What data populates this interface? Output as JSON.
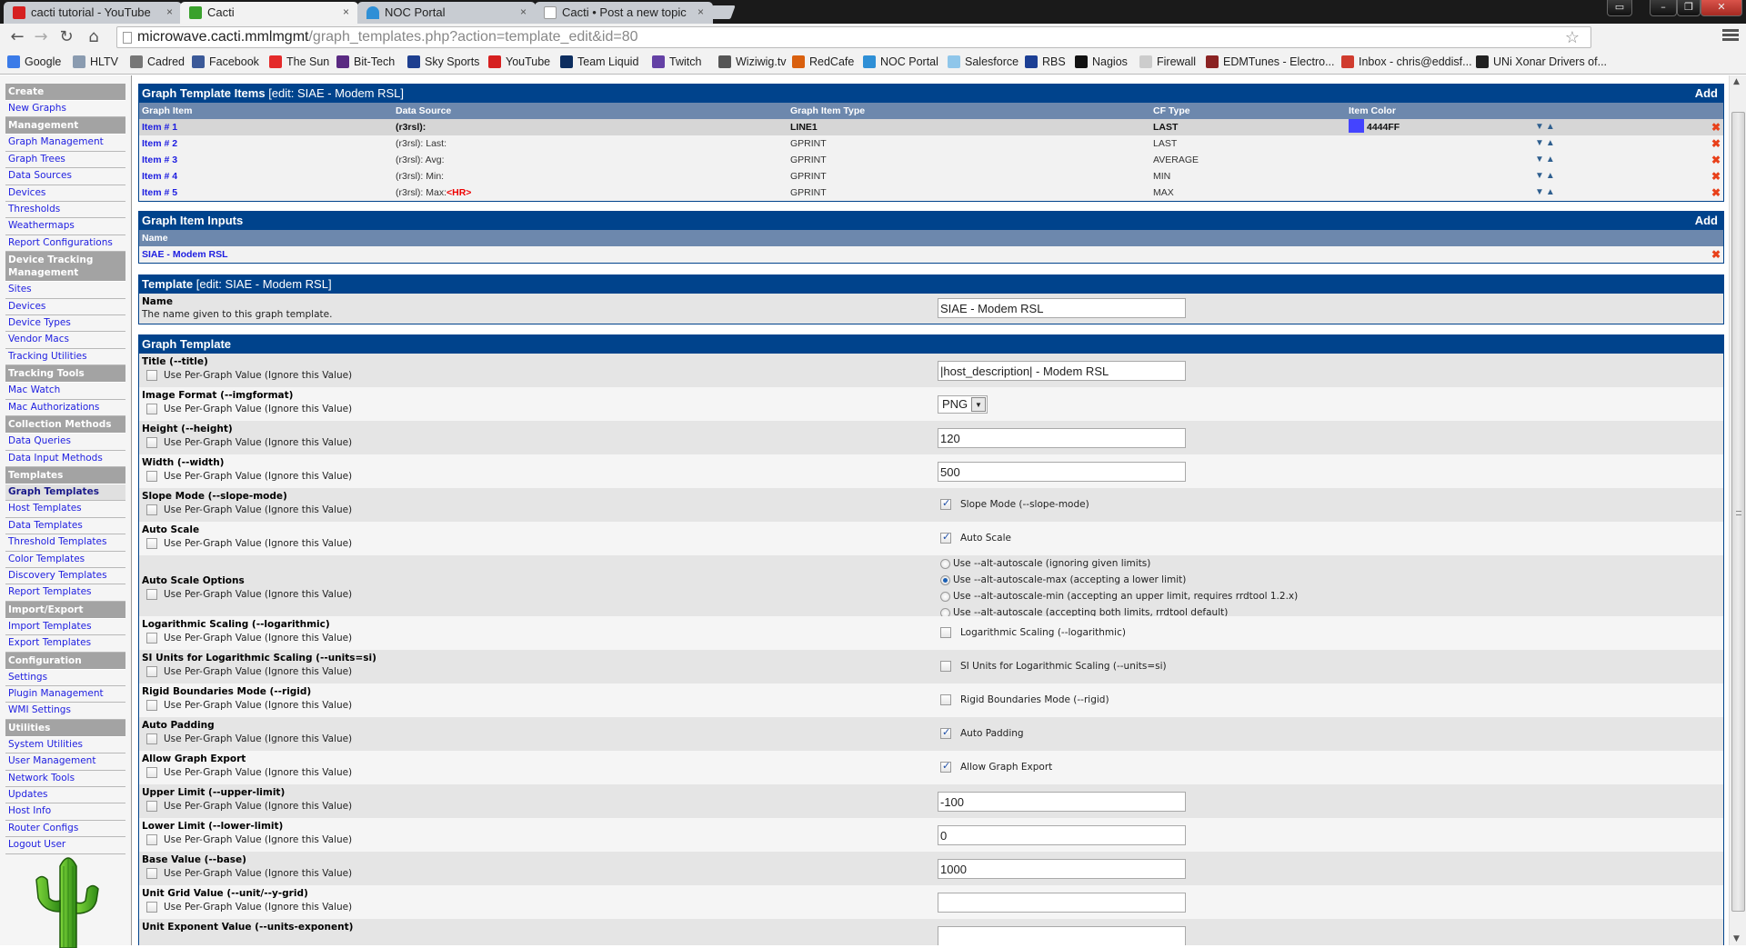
{
  "browser": {
    "tabs": [
      {
        "label": "cacti tutorial - YouTube",
        "icon": "youtube-icon",
        "active": false
      },
      {
        "label": "Cacti",
        "icon": "cacti-icon",
        "active": true
      },
      {
        "label": "NOC Portal",
        "icon": "noc-portal-icon",
        "active": false
      },
      {
        "label": "Cacti • Post a new topic",
        "icon": "page-icon",
        "active": false
      }
    ],
    "close_glyph": "×",
    "url_host": "microwave.cacti.mmlmgmt",
    "url_path": "/graph_templates.php?action=template_edit&id=80",
    "bookmarks": [
      {
        "label": "Google",
        "icon": "google-icon",
        "color": "#3b7be8"
      },
      {
        "label": "HLTV",
        "icon": "hltv-icon",
        "color": "#8a9bb0"
      },
      {
        "label": "Cadred",
        "icon": "cadred-icon",
        "color": "#777777"
      },
      {
        "label": "Facebook",
        "icon": "facebook-icon",
        "color": "#3b5998"
      },
      {
        "label": "The Sun",
        "icon": "the-sun-icon",
        "color": "#e42a2a"
      },
      {
        "label": "Bit-Tech",
        "icon": "bit-tech-icon",
        "color": "#5a2a82"
      },
      {
        "label": "Sky Sports",
        "icon": "sky-sports-icon",
        "color": "#1e3f8f"
      },
      {
        "label": "YouTube",
        "icon": "youtube-icon",
        "color": "#d62020"
      },
      {
        "label": "Team Liquid",
        "icon": "team-liquid-icon",
        "color": "#0d2d5f"
      },
      {
        "label": "Twitch",
        "icon": "twitch-icon",
        "color": "#6441a5"
      },
      {
        "label": "Wiziwig.tv",
        "icon": "wiziwig-icon",
        "color": "#555555"
      },
      {
        "label": "RedCafe",
        "icon": "redcafe-icon",
        "color": "#d9600f"
      },
      {
        "label": "NOC Portal",
        "icon": "noc-portal-icon",
        "color": "#2e8fd6"
      },
      {
        "label": "Salesforce",
        "icon": "salesforce-icon",
        "color": "#8fc6ea"
      },
      {
        "label": "RBS",
        "icon": "rbs-icon",
        "color": "#1c3f94"
      },
      {
        "label": "Nagios",
        "icon": "nagios-icon",
        "color": "#111111"
      },
      {
        "label": "Firewall",
        "icon": "page-icon",
        "color": "#cccccc"
      },
      {
        "label": "EDMTunes - Electro...",
        "icon": "edmtunes-icon",
        "color": "#8b2323"
      },
      {
        "label": "Inbox - chris@eddisf...",
        "icon": "gmail-icon",
        "color": "#d03c2f"
      },
      {
        "label": "UNi Xonar Drivers of...",
        "icon": "mt-icon",
        "color": "#222222"
      }
    ]
  },
  "sidebar": {
    "sections": [
      {
        "title": "Create",
        "items": [
          {
            "label": "New Graphs"
          }
        ]
      },
      {
        "title": "Management",
        "items": [
          {
            "label": "Graph Management"
          },
          {
            "label": "Graph Trees"
          },
          {
            "label": "Data Sources"
          },
          {
            "label": "Devices"
          },
          {
            "label": "Thresholds"
          },
          {
            "label": "Weathermaps"
          },
          {
            "label": "Report Configurations"
          }
        ]
      },
      {
        "title": "Device Tracking Management",
        "items": [
          {
            "label": "Sites"
          },
          {
            "label": "Devices"
          },
          {
            "label": "Device Types"
          },
          {
            "label": "Vendor Macs"
          },
          {
            "label": "Tracking Utilities"
          }
        ]
      },
      {
        "title": "Tracking Tools",
        "items": [
          {
            "label": "Mac Watch"
          },
          {
            "label": "Mac Authorizations"
          }
        ]
      },
      {
        "title": "Collection Methods",
        "items": [
          {
            "label": "Data Queries"
          },
          {
            "label": "Data Input Methods"
          }
        ]
      },
      {
        "title": "Templates",
        "items": [
          {
            "label": "Graph Templates",
            "selected": true
          },
          {
            "label": "Host Templates"
          },
          {
            "label": "Data Templates"
          },
          {
            "label": "Threshold Templates"
          },
          {
            "label": "Color Templates"
          },
          {
            "label": "Discovery Templates"
          },
          {
            "label": "Report Templates"
          }
        ]
      },
      {
        "title": "Import/Export",
        "items": [
          {
            "label": "Import Templates"
          },
          {
            "label": "Export Templates"
          }
        ]
      },
      {
        "title": "Configuration",
        "items": [
          {
            "label": "Settings"
          },
          {
            "label": "Plugin Management"
          },
          {
            "label": "WMI Settings"
          }
        ]
      },
      {
        "title": "Utilities",
        "items": [
          {
            "label": "System Utilities"
          },
          {
            "label": "User Management"
          },
          {
            "label": "Network Tools"
          },
          {
            "label": "Updates"
          },
          {
            "label": "Host Info"
          },
          {
            "label": "Router Configs"
          },
          {
            "label": "Logout User"
          }
        ]
      }
    ]
  },
  "items_panel": {
    "title": "Graph Template Items",
    "title_suffix": " [edit: SIAE - Modem RSL]",
    "add_label": "Add",
    "columns": [
      "Graph Item",
      "Data Source",
      "Graph Item Type",
      "CF Type",
      "Item Color"
    ],
    "rows": [
      {
        "item": "Item # 1",
        "source": "(r3rsl):",
        "source_extra": "",
        "type": "LINE1",
        "cf": "LAST",
        "color": "4444FF",
        "color_hex": "#4444FF"
      },
      {
        "item": "Item # 2",
        "source": "(r3rsl): Last:",
        "source_extra": "",
        "type": "GPRINT",
        "cf": "LAST",
        "color": "",
        "color_hex": ""
      },
      {
        "item": "Item # 3",
        "source": "(r3rsl): Avg:",
        "source_extra": "",
        "type": "GPRINT",
        "cf": "AVERAGE",
        "color": "",
        "color_hex": ""
      },
      {
        "item": "Item # 4",
        "source": "(r3rsl): Min:",
        "source_extra": "",
        "type": "GPRINT",
        "cf": "MIN",
        "color": "",
        "color_hex": ""
      },
      {
        "item": "Item # 5",
        "source": "(r3rsl): Max:",
        "source_extra": "<HR>",
        "type": "GPRINT",
        "cf": "MAX",
        "color": "",
        "color_hex": ""
      }
    ],
    "move_down_glyph": "▼",
    "move_up_glyph": "▲",
    "delete_glyph": "✖"
  },
  "inputs_panel": {
    "title": "Graph Item Inputs",
    "add_label": "Add",
    "column": "Name",
    "rows": [
      {
        "name": "SIAE - Modem RSL"
      }
    ]
  },
  "template_panel": {
    "title": "Template",
    "title_suffix": " [edit: SIAE - Modem RSL]",
    "name_label": "Name",
    "name_desc": "The name given to this graph template.",
    "name_value": "SIAE - Modem RSL"
  },
  "graph_panel": {
    "title": "Graph Template",
    "per_graph_label": "Use Per-Graph Value (Ignore this Value)",
    "fields": [
      {
        "label": "Title (--title)",
        "kind": "text",
        "value": "|host_description| - Modem RSL"
      },
      {
        "label": "Image Format (--imgformat)",
        "kind": "select",
        "value": "PNG"
      },
      {
        "label": "Height (--height)",
        "kind": "text",
        "value": "120"
      },
      {
        "label": "Width (--width)",
        "kind": "text",
        "value": "500"
      },
      {
        "label": "Slope Mode (--slope-mode)",
        "kind": "check",
        "check_label": "Slope Mode (--slope-mode)",
        "checked": true
      },
      {
        "label": "Auto Scale",
        "kind": "check",
        "check_label": "Auto Scale",
        "checked": true
      },
      {
        "label": "Auto Scale Options",
        "kind": "radio",
        "options": [
          {
            "label": "Use --alt-autoscale (ignoring given limits)",
            "selected": false
          },
          {
            "label": "Use --alt-autoscale-max (accepting a lower limit)",
            "selected": true
          },
          {
            "label": "Use --alt-autoscale-min (accepting an upper limit, requires rrdtool 1.2.x)",
            "selected": false
          },
          {
            "label": "Use --alt-autoscale (accepting both limits, rrdtool default)",
            "selected": false
          }
        ]
      },
      {
        "label": "Logarithmic Scaling (--logarithmic)",
        "kind": "check",
        "check_label": "Logarithmic Scaling (--logarithmic)",
        "checked": false
      },
      {
        "label": "SI Units for Logarithmic Scaling (--units=si)",
        "kind": "check",
        "check_label": "SI Units for Logarithmic Scaling (--units=si)",
        "checked": false
      },
      {
        "label": "Rigid Boundaries Mode (--rigid)",
        "kind": "check",
        "check_label": "Rigid Boundaries Mode (--rigid)",
        "checked": false
      },
      {
        "label": "Auto Padding",
        "kind": "check",
        "check_label": "Auto Padding",
        "checked": true
      },
      {
        "label": "Allow Graph Export",
        "kind": "check",
        "check_label": "Allow Graph Export",
        "checked": true
      },
      {
        "label": "Upper Limit (--upper-limit)",
        "kind": "text",
        "value": "-100"
      },
      {
        "label": "Lower Limit (--lower-limit)",
        "kind": "text",
        "value": "0"
      },
      {
        "label": "Base Value (--base)",
        "kind": "text",
        "value": "1000"
      },
      {
        "label": "Unit Grid Value (--unit/--y-grid)",
        "kind": "text",
        "value": ""
      },
      {
        "label": "Unit Exponent Value (--units-exponent)",
        "kind": "text",
        "value": ""
      }
    ]
  }
}
